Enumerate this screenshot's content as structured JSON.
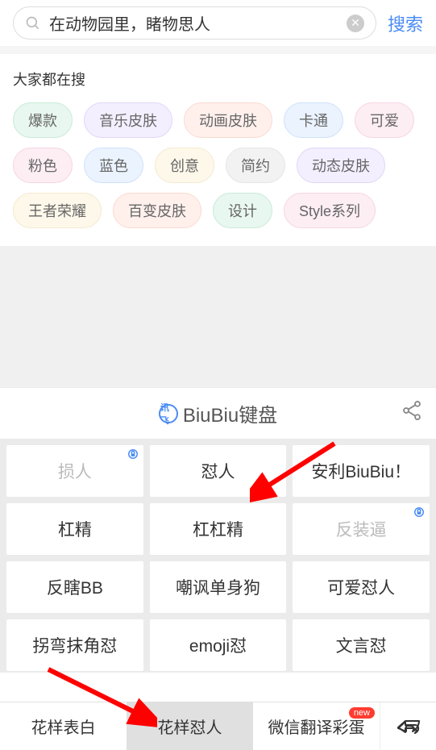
{
  "search": {
    "value": "在动物园里，睹物思人",
    "action": "搜索"
  },
  "trending": {
    "title": "大家都在搜",
    "tags": [
      {
        "label": "爆款",
        "style": "mint"
      },
      {
        "label": "音乐皮肤",
        "style": "lavender"
      },
      {
        "label": "动画皮肤",
        "style": "peach"
      },
      {
        "label": "卡通",
        "style": "sky"
      },
      {
        "label": "可爱",
        "style": "pink"
      },
      {
        "label": "粉色",
        "style": "pink"
      },
      {
        "label": "蓝色",
        "style": "sky"
      },
      {
        "label": "创意",
        "style": "yellow"
      },
      {
        "label": "简约",
        "style": "gray"
      },
      {
        "label": "动态皮肤",
        "style": "lavender"
      },
      {
        "label": "王者荣耀",
        "style": "yellow"
      },
      {
        "label": "百变皮肤",
        "style": "peach"
      },
      {
        "label": "设计",
        "style": "mint"
      },
      {
        "label": "Style系列",
        "style": "pink"
      }
    ]
  },
  "keyboard": {
    "title": "BiuBiu键盘",
    "logo_text": "讯飞",
    "cells": [
      [
        {
          "label": "损人",
          "locked": true
        },
        {
          "label": "怼人",
          "locked": false
        },
        {
          "label": "安利BiuBiu！",
          "locked": false
        }
      ],
      [
        {
          "label": "杠精",
          "locked": false
        },
        {
          "label": "杠杠精",
          "locked": false
        },
        {
          "label": "反装逼",
          "locked": true
        }
      ],
      [
        {
          "label": "反瞎BB",
          "locked": false
        },
        {
          "label": "嘲讽单身狗",
          "locked": false
        },
        {
          "label": "可爱怼人",
          "locked": false
        }
      ],
      [
        {
          "label": "拐弯抹角怼",
          "locked": false
        },
        {
          "label": "emoji怼",
          "locked": false
        },
        {
          "label": "文言怼",
          "locked": false
        }
      ]
    ]
  },
  "bottom_tabs": {
    "items": [
      {
        "label": "花样表白",
        "active": false,
        "new": false
      },
      {
        "label": "花样怼人",
        "active": true,
        "new": false
      },
      {
        "label": "微信翻译彩蛋",
        "active": false,
        "new": true
      }
    ],
    "new_badge": "new"
  }
}
